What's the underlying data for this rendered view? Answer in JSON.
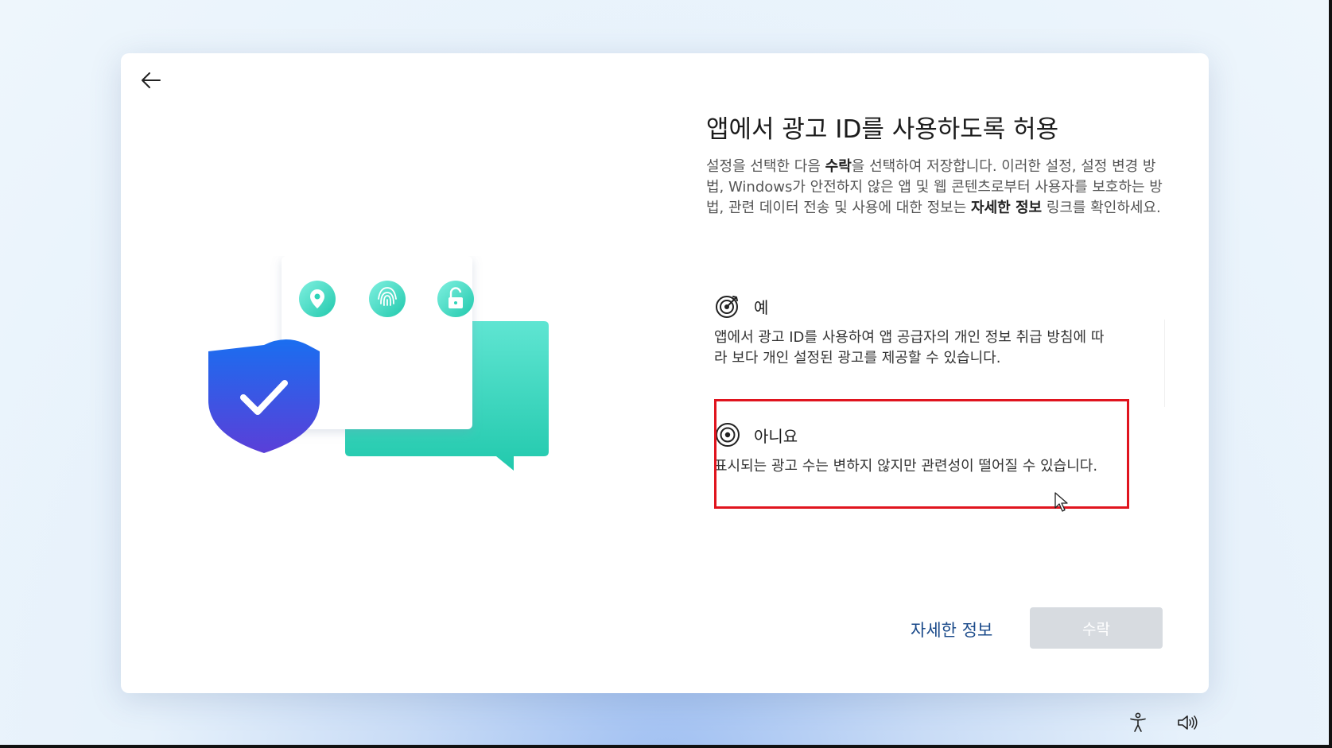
{
  "header": {
    "title": "앱에서 광고 ID를 사용하도록 허용"
  },
  "description": {
    "part1": "설정을 선택한 다음 ",
    "accept_word": "수락",
    "part2": "을 선택하여 저장합니다. 이러한 설정, 설정 변경 방법, Windows가 안전하지 않은 앱 및 웹 콘텐츠로부터 사용자를 보호하는 방법, 관련 데이터 전송 및 사용에 대한 정보는 ",
    "more_word": "자세한 정보",
    "part3": " 링크를 확인하세요."
  },
  "options": [
    {
      "label": "예",
      "text": "앱에서 광고 ID를 사용하여 앱 공급자의 개인 정보 취급 방침에 따라 보다 개인 설정된 광고를 제공할 수 있습니다.",
      "icon": "target-arrow-icon",
      "selected": false
    },
    {
      "label": "아니요",
      "text": "표시되는 광고 수는 변하지 않지만 관련성이 떨어질 수 있습니다.",
      "icon": "target-icon",
      "selected": true
    }
  ],
  "footer": {
    "more_info_label": "자세한 정보",
    "accept_label": "수락"
  },
  "colors": {
    "accent_link": "#1a4a8a",
    "highlight_border": "#e0141e",
    "button_disabled": "#d7dbe0",
    "shield_top": "#1a6ef0",
    "shield_bottom": "#5a3fd8",
    "teal": "#2fd4b8"
  },
  "icons": {
    "back": "back-arrow-icon",
    "location": "location-pin-icon",
    "fingerprint": "fingerprint-icon",
    "unlock": "unlock-icon",
    "shield": "shield-check-icon",
    "accessibility": "accessibility-icon",
    "volume": "volume-icon"
  }
}
